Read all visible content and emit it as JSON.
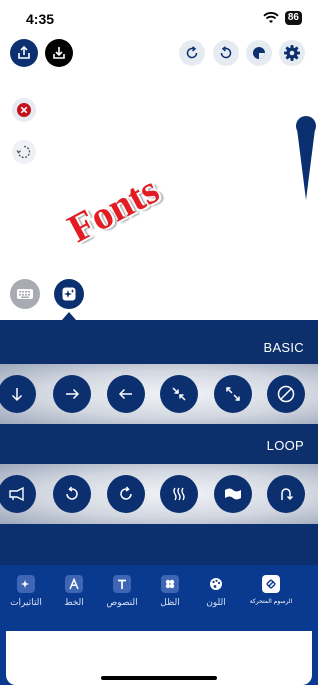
{
  "status_bar": {
    "time": "4:35",
    "battery": "86"
  },
  "canvas": {
    "text_layer": "Fonts",
    "text_color": "#e31b23"
  },
  "panel": {
    "sections": [
      {
        "label": "BASIC",
        "items": [
          "arrow-down-icon",
          "arrow-right-icon",
          "arrow-left-icon",
          "shrink-icon",
          "expand-icon",
          "no-animation-icon"
        ]
      },
      {
        "label": "LOOP",
        "items": [
          "trumpet-icon",
          "rotate-ccw-icon",
          "rotate-cw-icon",
          "wave-icon",
          "flag-icon",
          "u-turn-icon"
        ]
      }
    ]
  },
  "tabs": [
    {
      "label": "التاثيرات",
      "icon": "effects-icon"
    },
    {
      "label": "الخط",
      "icon": "font-a-icon"
    },
    {
      "label": "النصوص",
      "icon": "text-t-icon"
    },
    {
      "label": "الظل",
      "icon": "shadow-icon"
    },
    {
      "label": "اللون",
      "icon": "palette-icon"
    },
    {
      "label": "الرسوم المتحركة",
      "icon": "animation-icon",
      "active": true
    }
  ],
  "colors": {
    "primary": "#0b2f6f",
    "tab_bar": "#0a3a8f",
    "accent_red": "#c4121b"
  }
}
